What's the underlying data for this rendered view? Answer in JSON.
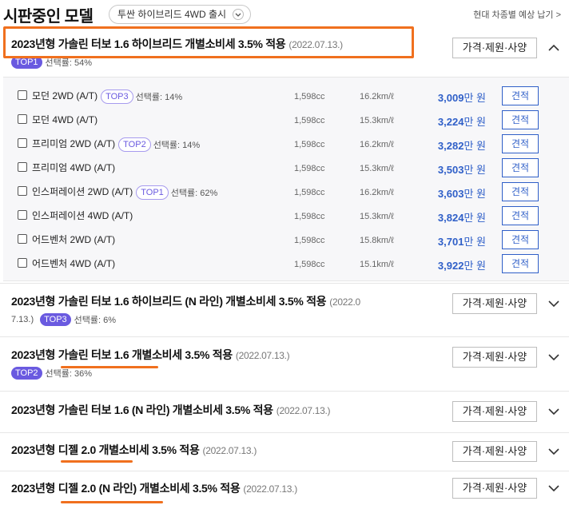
{
  "header": {
    "title": "시판중인 모델",
    "model_select": "투싼 하이브리드 4WD 출시",
    "right_link": "현대 차종별 예상 납기 >"
  },
  "colors": {
    "accent": "#6a5ae0",
    "price": "#2f5fc8",
    "highlight": "#f0701e"
  },
  "groups": [
    {
      "title": "2023년형 가솔린 터보 1.6 하이브리드 개별소비세 3.5% 적용",
      "date": "(2022.07.13.)",
      "badge": "TOP1",
      "selection": "선택률: 54%",
      "spec_button": "가격·제원·사양",
      "expanded": true,
      "icon": "chevron-up-icon"
    },
    {
      "title": "2023년형 가솔린 터보 1.6 하이브리드 (N 라인) 개별소비세 3.5% 적용",
      "date": "(2022.0",
      "date_cont": "7.13.)",
      "badge": "TOP3",
      "selection": "선택률: 6%",
      "spec_button": "가격·제원·사양",
      "expanded": false,
      "icon": "chevron-down-icon"
    },
    {
      "title": "2023년형 가솔린 터보 1.6 개별소비세 3.5% 적용",
      "date": "(2022.07.13.)",
      "badge": "TOP2",
      "selection": "선택률: 36%",
      "spec_button": "가격·제원·사양",
      "expanded": false,
      "icon": "chevron-down-icon"
    },
    {
      "title": "2023년형 가솔린 터보 1.6 (N 라인) 개별소비세 3.5% 적용",
      "date": "(2022.07.13.)",
      "spec_button": "가격·제원·사양",
      "expanded": false,
      "icon": "chevron-down-icon"
    },
    {
      "title": "2023년형 디젤 2.0 개별소비세 3.5% 적용",
      "date": "(2022.07.13.)",
      "spec_button": "가격·제원·사양",
      "expanded": false,
      "icon": "chevron-down-icon"
    },
    {
      "title": "2023년형 디젤 2.0 (N 라인) 개별소비세 3.5% 적용",
      "date": "(2022.07.13.)",
      "spec_button": "가격·제원·사양",
      "expanded": false,
      "icon": "chevron-down-icon"
    }
  ],
  "trims": [
    {
      "name": "모던 2WD (A/T)",
      "badge": "TOP3",
      "selection": "선택률: 14%",
      "cc": "1,598cc",
      "efficiency": "16.2km/ℓ",
      "price": "3,009",
      "unit": "만 원",
      "button": "견적"
    },
    {
      "name": "모던 4WD (A/T)",
      "badge": "",
      "selection": "",
      "cc": "1,598cc",
      "efficiency": "15.3km/ℓ",
      "price": "3,224",
      "unit": "만 원",
      "button": "견적"
    },
    {
      "name": "프리미엄 2WD (A/T)",
      "badge": "TOP2",
      "selection": "선택률: 14%",
      "cc": "1,598cc",
      "efficiency": "16.2km/ℓ",
      "price": "3,282",
      "unit": "만 원",
      "button": "견적"
    },
    {
      "name": "프리미엄 4WD (A/T)",
      "badge": "",
      "selection": "",
      "cc": "1,598cc",
      "efficiency": "15.3km/ℓ",
      "price": "3,503",
      "unit": "만 원",
      "button": "견적"
    },
    {
      "name": "인스퍼레이션 2WD (A/T)",
      "badge": "TOP1",
      "selection": "선택률: 62%",
      "cc": "1,598cc",
      "efficiency": "16.2km/ℓ",
      "price": "3,603",
      "unit": "만 원",
      "button": "견적"
    },
    {
      "name": "인스퍼레이션 4WD (A/T)",
      "badge": "",
      "selection": "",
      "cc": "1,598cc",
      "efficiency": "15.3km/ℓ",
      "price": "3,824",
      "unit": "만 원",
      "button": "견적"
    },
    {
      "name": "어드벤처 2WD (A/T)",
      "badge": "",
      "selection": "",
      "cc": "1,598cc",
      "efficiency": "15.8km/ℓ",
      "price": "3,701",
      "unit": "만 원",
      "button": "견적"
    },
    {
      "name": "어드벤처 4WD (A/T)",
      "badge": "",
      "selection": "",
      "cc": "1,598cc",
      "efficiency": "15.1km/ℓ",
      "price": "3,922",
      "unit": "만 원",
      "button": "견적"
    }
  ]
}
